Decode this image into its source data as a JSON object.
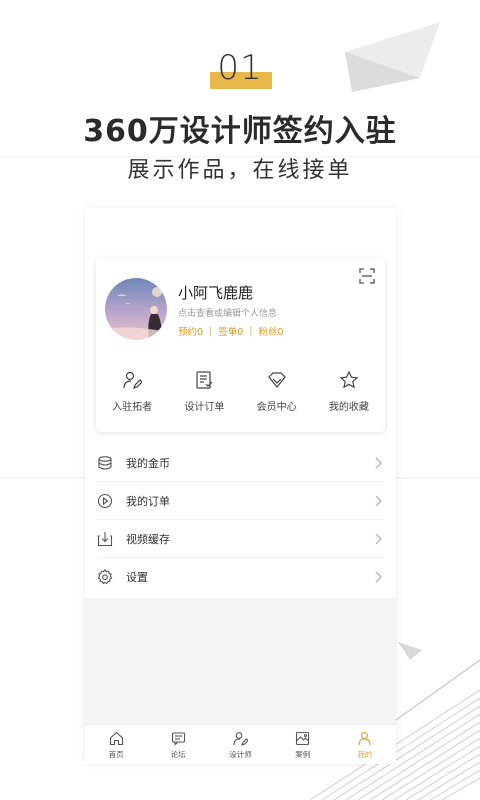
{
  "hero": {
    "number": "01",
    "title": "360万设计师签约入驻",
    "subtitle": "展示作品，在线接单"
  },
  "colors": {
    "accent": "#e8b74a",
    "accent_text": "#d99a2b",
    "tab_active": "#e2a43a"
  },
  "profile": {
    "name": "小阿飞鹿鹿",
    "hint": "点击查看或编辑个人信息",
    "stats": [
      "预约0",
      "签单0",
      "粉丝0"
    ],
    "scan_icon": "scan-icon"
  },
  "quick_actions": [
    {
      "label": "入驻拓者",
      "icon": "user-edit-icon"
    },
    {
      "label": "设计订单",
      "icon": "order-doc-icon"
    },
    {
      "label": "会员中心",
      "icon": "diamond-icon"
    },
    {
      "label": "我的收藏",
      "icon": "star-icon"
    }
  ],
  "menu": [
    {
      "label": "我的金币",
      "icon": "coins-icon"
    },
    {
      "label": "我的订单",
      "icon": "play-circle-icon"
    },
    {
      "label": "视频缓存",
      "icon": "download-icon"
    },
    {
      "label": "设置",
      "icon": "gear-icon"
    }
  ],
  "tabbar": [
    {
      "label": "首页",
      "icon": "home-icon",
      "active": false
    },
    {
      "label": "论坛",
      "icon": "forum-icon",
      "active": false
    },
    {
      "label": "设计师",
      "icon": "designer-icon",
      "active": false
    },
    {
      "label": "案例",
      "icon": "case-icon",
      "active": false
    },
    {
      "label": "我的",
      "icon": "user-icon",
      "active": true
    }
  ]
}
